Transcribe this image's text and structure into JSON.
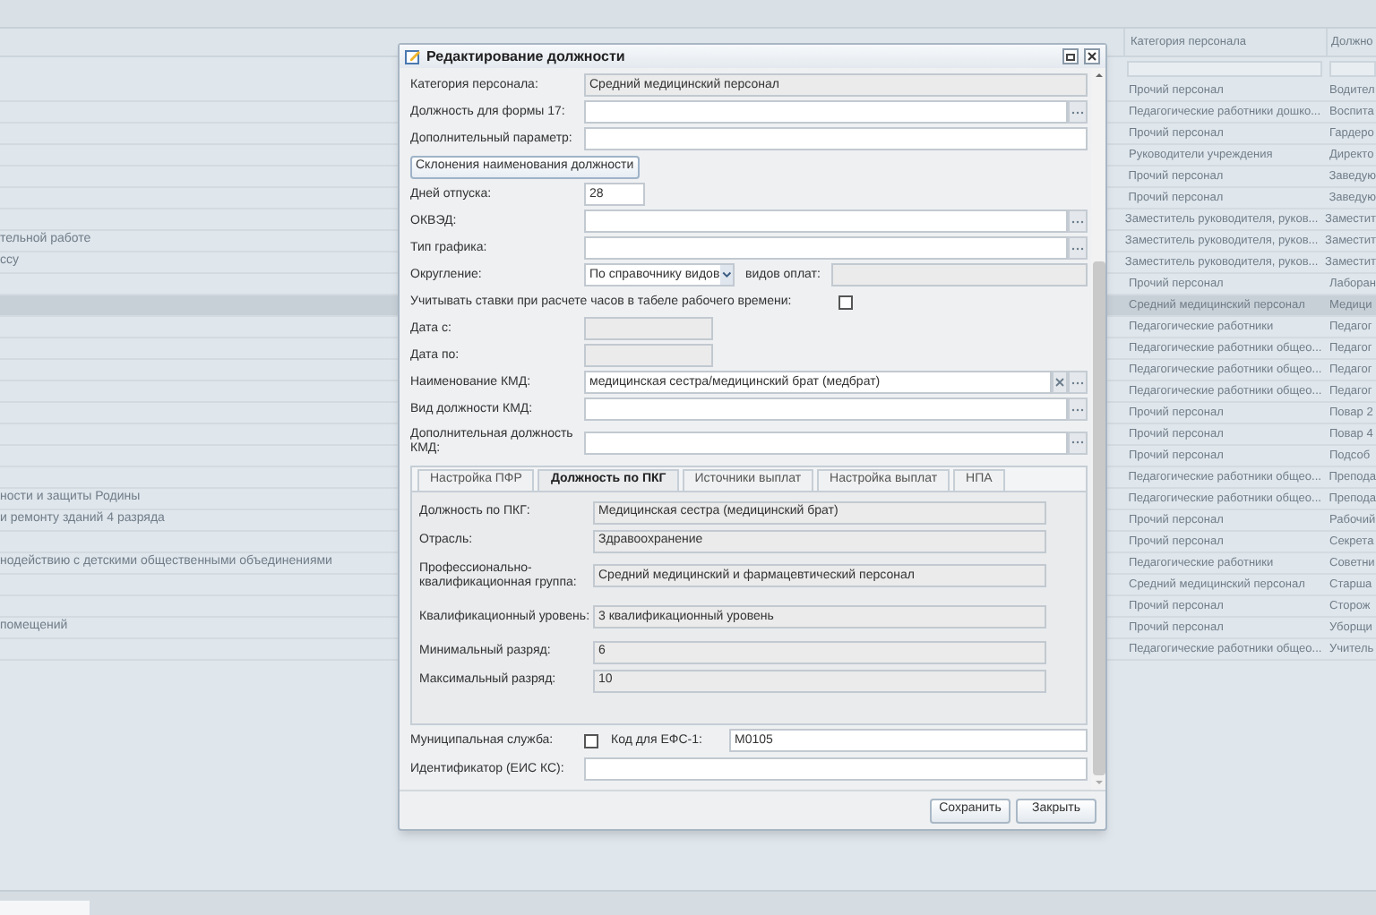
{
  "grid": {
    "columns": [
      {
        "label": "Категория персонала"
      },
      {
        "label": "Должно"
      }
    ],
    "rows": [
      {
        "column_1": "",
        "category": "Прочий персонал",
        "position": "Водител",
        "selected": false
      },
      {
        "column_1": "",
        "category": "Педагогические работники дошко...",
        "position": "Воспита",
        "selected": false
      },
      {
        "column_1": "",
        "category": "Прочий персонал",
        "position": "Гардеро",
        "selected": false
      },
      {
        "column_1": "",
        "category": "Руководители учреждения",
        "position": "Директо",
        "selected": false
      },
      {
        "column_1": "",
        "category": "Прочий персонал",
        "position": "Заведую",
        "selected": false
      },
      {
        "column_1": "",
        "category": "Прочий персонал",
        "position": "Заведую",
        "selected": false
      },
      {
        "column_1": "",
        "category": "Заместитель руководителя, руков...",
        "position": "Заместит",
        "selected": false
      },
      {
        "column_1": "тельной работе",
        "category": "Заместитель руководителя, руков...",
        "position": "Заместит",
        "selected": false
      },
      {
        "column_1": "ссу",
        "category": "Заместитель руководителя, руков...",
        "position": "Заместит",
        "selected": false
      },
      {
        "column_1": "",
        "category": "Прочий персонал",
        "position": "Лаборан",
        "selected": false
      },
      {
        "column_1": "",
        "category": "Средний медицинский персонал",
        "position": "Медици",
        "selected": true
      },
      {
        "column_1": "",
        "category": "Педагогические работники",
        "position": "Педагог",
        "selected": false
      },
      {
        "column_1": "",
        "category": "Педагогические работники общео...",
        "position": "Педагог",
        "selected": false
      },
      {
        "column_1": "",
        "category": "Педагогические работники общео...",
        "position": "Педагог",
        "selected": false
      },
      {
        "column_1": "",
        "category": "Педагогические работники общео...",
        "position": "Педагог",
        "selected": false
      },
      {
        "column_1": "",
        "category": "Прочий персонал",
        "position": "Повар 2",
        "selected": false
      },
      {
        "column_1": "",
        "category": "Прочий персонал",
        "position": "Повар 4",
        "selected": false
      },
      {
        "column_1": "",
        "category": "Прочий персонал",
        "position": "Подсоб",
        "selected": false
      },
      {
        "column_1": "",
        "category": "Педагогические работники общео...",
        "position": "Препода",
        "selected": false
      },
      {
        "column_1": "ности и защиты Родины",
        "category": "Педагогические работники общео...",
        "position": "Препода",
        "selected": false
      },
      {
        "column_1": "и ремонту зданий 4 разряда",
        "category": "Прочий персонал",
        "position": "Рабочий",
        "selected": false
      },
      {
        "column_1": "",
        "category": "Прочий персонал",
        "position": "Секрета",
        "selected": false
      },
      {
        "column_1": "нодействию с детскими общественными объединениями",
        "category": "Педагогические работники",
        "position": "Советни",
        "selected": false
      },
      {
        "column_1": "",
        "category": "Средний медицинский персонал",
        "position": "Старша",
        "selected": false
      },
      {
        "column_1": "",
        "category": "Прочий персонал",
        "position": "Сторож",
        "selected": false
      },
      {
        "column_1": "помещений",
        "category": "Прочий персонал",
        "position": "Уборщи",
        "selected": false
      },
      {
        "column_1": "",
        "category": "Педагогические работники общео...",
        "position": "Учитель",
        "selected": false
      }
    ]
  },
  "dialog": {
    "title": "Редактирование должности",
    "fields": [
      {
        "kind": "readonly",
        "label": "Категория персонала:",
        "value": "Средний медицинский персонал"
      },
      {
        "kind": "picker",
        "label": "Должность для формы 17:"
      },
      {
        "kind": "text",
        "label": "Дополнительный параметр:"
      },
      {
        "kind": "button",
        "label": "Склонения наименования должности"
      },
      {
        "kind": "short",
        "label": "Дней отпуска:",
        "value": "28"
      },
      {
        "kind": "picker",
        "label": "ОКВЭД:"
      },
      {
        "kind": "picker",
        "label": "Тип графика:"
      },
      {
        "kind": "combo",
        "label": "Округление:",
        "value": "По справочнику видов",
        "extra_label": "видов оплат:"
      },
      {
        "kind": "checkbox",
        "label": "Учитывать ставки при расчете часов в табеле рабочего времени:",
        "checked": false
      },
      {
        "kind": "date",
        "label": "Дата с:"
      },
      {
        "kind": "date",
        "label": "Дата по:"
      },
      {
        "kind": "picker",
        "label": "Наименование КМД:",
        "value": "медицинская сестра/медицинский брат (медбрат)",
        "clearable": true
      },
      {
        "kind": "picker",
        "label": "Вид должности КМД:"
      },
      {
        "kind": "picker",
        "label": "Дополнительная должность КМД:",
        "tall": true
      }
    ],
    "tabs": [
      {
        "label": "Настройка ПФР",
        "selected": false
      },
      {
        "label": "Должность по ПКГ",
        "selected": true
      },
      {
        "label": "Источники выплат",
        "selected": false
      },
      {
        "label": "Настройка выплат",
        "selected": false
      },
      {
        "label": "НПА",
        "selected": false
      }
    ],
    "tab_fields": [
      {
        "label": "Должность по ПКГ:",
        "value": "Медицинская сестра (медицинский брат)"
      },
      {
        "label": "Отрасль:",
        "value": "Здравоохранение"
      },
      {
        "label": "Профессионально-квалификационная группа:",
        "value": "Средний медицинский и фармацевтический персонал",
        "tall": true
      },
      {
        "label": "Квалификационный уровень:",
        "value": "3 квалификационный уровень",
        "tall": true
      },
      {
        "label": "Минимальный разряд:",
        "value": "6"
      },
      {
        "label": "Максимальный разряд:",
        "value": "10"
      }
    ],
    "municipal": {
      "label": "Муниципальная служба:",
      "checked": false
    },
    "efs_code": {
      "label": "Код для ЕФС-1:",
      "value": "М0105"
    },
    "identifier": {
      "label": "Идентификатор (ЕИС КС):"
    },
    "buttons": [
      "Сохранить",
      "Закрыть"
    ]
  }
}
